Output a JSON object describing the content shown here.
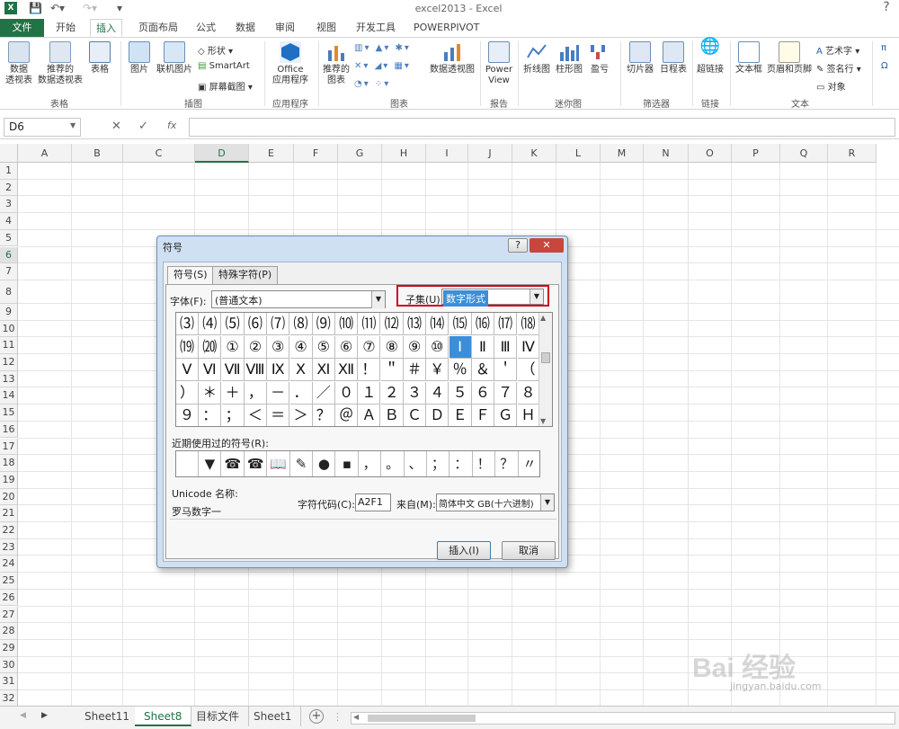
{
  "window": {
    "title": "excel2013 - Excel",
    "logo": "X"
  },
  "ribbon_tabs": [
    "文件",
    "开始",
    "插入",
    "页面布局",
    "公式",
    "数据",
    "审阅",
    "视图",
    "开发工具",
    "POWERPIVOT"
  ],
  "ribbon": {
    "pivot": "数据\n透视表",
    "recommended_pivot": "推荐的\n数据透视表",
    "table": "表格",
    "group_tables": "表格",
    "picture": "图片",
    "online_picture": "联机图片",
    "shapes": "形状",
    "smartart": "SmartArt",
    "screenshot": "屏幕截图",
    "group_illustrations": "插图",
    "office_app": "Office\n应用程序",
    "group_apps": "应用程序",
    "recommended_charts": "推荐的\n图表",
    "pivot_chart": "数据透视图",
    "group_charts": "图表",
    "power_view": "Power\nView",
    "group_reports": "报告",
    "spark_line": "折线图",
    "spark_column": "柱形图",
    "spark_winloss": "盈亏",
    "group_sparklines": "迷你图",
    "slicer": "切片器",
    "timeline": "日程表",
    "group_filters": "筛选器",
    "hyperlink": "超链接",
    "group_links": "链接",
    "textbox": "文本框",
    "header_footer": "页眉和页脚",
    "wordart": "艺术字",
    "signature": "签名行",
    "object": "对象",
    "group_text": "文本"
  },
  "formula_bar": {
    "name_box": "D6",
    "cancel": "✕",
    "enter": "✓",
    "fx": "fx"
  },
  "columns": [
    "A",
    "B",
    "C",
    "D",
    "E",
    "F",
    "G",
    "H",
    "I",
    "J",
    "K",
    "L",
    "M",
    "N",
    "O",
    "P",
    "Q",
    "R"
  ],
  "rows": [
    "1",
    "2",
    "3",
    "4",
    "5",
    "6",
    "7",
    "8",
    "9",
    "10",
    "11",
    "12",
    "13",
    "14",
    "15",
    "16",
    "17",
    "18",
    "19",
    "20",
    "21",
    "22",
    "23",
    "24",
    "25",
    "26",
    "27",
    "28",
    "29",
    "30",
    "31",
    "32"
  ],
  "sheet_tabs": [
    "Sheet11",
    "Sheet8",
    "目标文件",
    "Sheet1"
  ],
  "dialog": {
    "title": "符号",
    "tab_symbols": "符号(S)",
    "tab_special": "特殊字符(P)",
    "font_label": "字体(F):",
    "font_value": "(普通文本)",
    "subset_label": "子集(U):",
    "subset_value": "数字形式",
    "symbols": [
      [
        "⑶",
        "⑷",
        "⑸",
        "⑹",
        "⑺",
        "⑻",
        "⑼",
        "⑽",
        "⑾",
        "⑿",
        "⒀",
        "⒁",
        "⒂",
        "⒃",
        "⒄",
        "⒅"
      ],
      [
        "⒆",
        "⒇",
        "①",
        "②",
        "③",
        "④",
        "⑤",
        "⑥",
        "⑦",
        "⑧",
        "⑨",
        "⑩",
        "Ⅰ",
        "Ⅱ",
        "Ⅲ",
        "Ⅳ"
      ],
      [
        "Ⅴ",
        "Ⅵ",
        "Ⅶ",
        "Ⅷ",
        "Ⅸ",
        "Ⅹ",
        "Ⅺ",
        "Ⅻ",
        "！",
        "＂",
        "＃",
        "￥",
        "％",
        "＆",
        "＇",
        "（"
      ],
      [
        "）",
        "＊",
        "＋",
        "，",
        "－",
        "．",
        "／",
        "０",
        "１",
        "２",
        "３",
        "４",
        "５",
        "６",
        "７",
        "８"
      ],
      [
        "９",
        "：",
        "；",
        "＜",
        "＝",
        "＞",
        "？",
        "＠",
        "Ａ",
        "Ｂ",
        "Ｃ",
        "Ｄ",
        "Ｅ",
        "Ｆ",
        "Ｇ",
        "Ｈ"
      ]
    ],
    "recent_label": "近期使用过的符号(R):",
    "recent": [
      "",
      "▼",
      "☎",
      "☎",
      "📖",
      "✎",
      "●",
      "▪",
      "，",
      "。",
      "、",
      "；",
      "：",
      "！",
      "？",
      "〃"
    ],
    "unicode_label": "Unicode 名称:",
    "unicode_name": "罗马数字一",
    "charcode_label": "字符代码(C):",
    "charcode_value": "A2F1",
    "from_label": "来自(M):",
    "from_value": "简体中文 GB(十六进制)",
    "insert": "插入(I)",
    "cancel": "取消",
    "help": "?",
    "close": "✕"
  },
  "watermark": {
    "brand": "Bai 经验",
    "url": "jingyan.baidu.com"
  },
  "colors": {
    "excel_green": "#217346",
    "highlight_red": "#d0021b",
    "selection_blue": "#3c8ed8"
  }
}
